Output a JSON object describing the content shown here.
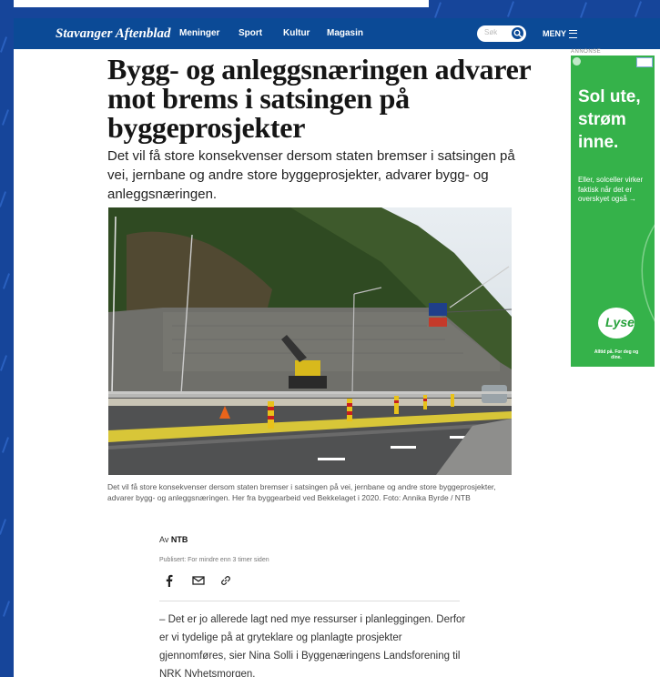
{
  "nav": {
    "logo": "Stavanger Aftenblad",
    "links": [
      "Meninger",
      "Sport",
      "Kultur",
      "Magasin"
    ],
    "search_placeholder": "Søk",
    "menu_label": "MENY"
  },
  "article": {
    "title": "Bygg- og anleggsnæringen advarer mot brems i satsingen på byggeprosjekter",
    "lead": "Det vil få store konsekvenser dersom staten bremser i satsingen på vei, jernbane og andre store byggeprosjekter, advarer bygg- og anleggsnæringen.",
    "caption": "Det vil få store konsekvenser dersom staten bremser i satsingen på vei, jernbane og andre store byggeprosjekter, advarer bygg- og anleggsnæringen. Her fra byggearbeid ved Bekkelaget i 2020. Foto: Annika Byrde / NTB",
    "byline_prefix": "Av",
    "author": "NTB",
    "published": "Publisert: For mindre enn 3 timer siden",
    "body": "– Det er jo allerede lagt ned mye ressurser i planleggingen. Derfor er vi tydelige på at gryteklare og planlagte prosjekter gjennomføres, sier Nina Solli i Byggenæringens Landsforening til NRK Nyhetsmorgen."
  },
  "share_icons": [
    "facebook-icon",
    "email-icon",
    "link-icon"
  ],
  "ad": {
    "label": "ANNONSE",
    "headline": "Sol ute, strøm inne.",
    "subtext": "Eller, solceller virker faktisk når det er overskyet også →",
    "logo": "Lyse",
    "tagline": "Alltid på. For deg og dine.",
    "color": "#35b24a"
  },
  "colors": {
    "brand": "#0b4a96",
    "background": "#16459a"
  }
}
